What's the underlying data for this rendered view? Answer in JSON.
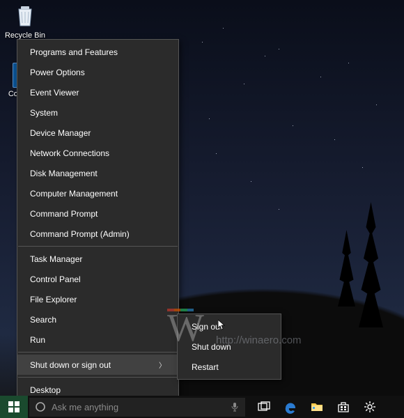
{
  "desktop": {
    "recycle_label": "Recycle Bin",
    "computer_label": "Computer"
  },
  "winx_menu": {
    "items": [
      {
        "label": "Programs and Features",
        "submenu": false
      },
      {
        "label": "Power Options",
        "submenu": false
      },
      {
        "label": "Event Viewer",
        "submenu": false
      },
      {
        "label": "System",
        "submenu": false
      },
      {
        "label": "Device Manager",
        "submenu": false
      },
      {
        "label": "Network Connections",
        "submenu": false
      },
      {
        "label": "Disk Management",
        "submenu": false
      },
      {
        "label": "Computer Management",
        "submenu": false
      },
      {
        "label": "Command Prompt",
        "submenu": false
      },
      {
        "label": "Command Prompt (Admin)",
        "submenu": false
      },
      {
        "sep": true
      },
      {
        "label": "Task Manager",
        "submenu": false
      },
      {
        "label": "Control Panel",
        "submenu": false
      },
      {
        "label": "File Explorer",
        "submenu": false
      },
      {
        "label": "Search",
        "submenu": false
      },
      {
        "label": "Run",
        "submenu": false
      },
      {
        "sep": true
      },
      {
        "label": "Shut down or sign out",
        "submenu": true,
        "highlighted": true
      },
      {
        "sep": true
      },
      {
        "label": "Desktop",
        "submenu": false
      }
    ]
  },
  "shutdown_submenu": {
    "items": [
      {
        "label": "Sign out"
      },
      {
        "label": "Shut down"
      },
      {
        "label": "Restart"
      }
    ]
  },
  "taskbar": {
    "search_placeholder": "Ask me anything"
  },
  "watermark": {
    "url": "http://winaero.com"
  }
}
